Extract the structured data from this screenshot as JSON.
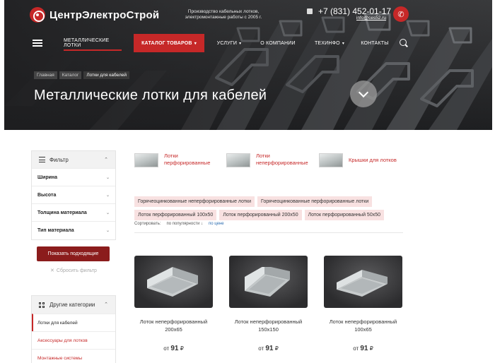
{
  "header": {
    "logo_text": "ЦентрЭлектроСтрой",
    "tagline_line1": "Производство кабельных лотков,",
    "tagline_line2": "электромонтажные работы с 2005 г.",
    "phone": "+7 (831) 452-01-17",
    "email": "info@ces52.ru"
  },
  "nav": {
    "items": [
      {
        "label": "МЕТАЛЛИЧЕСКИЕ ЛОТКИ",
        "caret": ""
      },
      {
        "label": "КАТАЛОГ ТОВАРОВ",
        "caret": "▾"
      },
      {
        "label": "УСЛУГИ",
        "caret": "▾"
      },
      {
        "label": "О КОМПАНИИ",
        "caret": ""
      },
      {
        "label": "ТЕХИНФО",
        "caret": "▾"
      },
      {
        "label": "КОНТАКТЫ",
        "caret": ""
      }
    ]
  },
  "breadcrumb": [
    "Главная",
    "Каталог",
    "Лотки для кабелей"
  ],
  "page_title": "Металлические лотки для кабелей",
  "filter": {
    "title": "Фильтр",
    "rows": [
      "Ширина",
      "Высота",
      "Толщина материала",
      "Тип материала"
    ],
    "submit_label": "Показать подходящие",
    "reset_label": "Сбросить фильтр"
  },
  "other_categories": {
    "title": "Другие категории",
    "items": [
      "Лотки для кабелей",
      "Аксессуары для лотков",
      "Монтажные системы"
    ]
  },
  "subcategories": [
    {
      "line1": "Лотки",
      "line2": "перфорированные"
    },
    {
      "line1": "Лотки",
      "line2": "неперфорированные"
    },
    {
      "line1": "Крышки для лотков",
      "line2": ""
    }
  ],
  "tags": {
    "row1": [
      "Горячеоцинкованные неперфорированные лотки",
      "Горячеоцинкованные перфорированные лотки"
    ],
    "row2": [
      "Лоток перфорированный 100х50",
      "Лоток перфорированный 200х50",
      "Лоток перфорированный 50х50"
    ]
  },
  "sort": {
    "label": "Сортировать:",
    "option1": "по популярности",
    "option1_arrow": "↓",
    "option2": "по цене"
  },
  "products": [
    {
      "name_line1": "Лоток неперфорированный",
      "name_line2": "200х65",
      "price_prefix": "от",
      "price": "91",
      "currency": "₽"
    },
    {
      "name_line1": "Лоток неперфорированный",
      "name_line2": "150х150",
      "price_prefix": "от",
      "price": "91",
      "currency": "₽"
    },
    {
      "name_line1": "Лоток неперфорированный",
      "name_line2": "100х65",
      "price_prefix": "от",
      "price": "91",
      "currency": "₽"
    }
  ],
  "colors": {
    "brand_red": "#c62828",
    "button_dark_red": "#8b1c1c",
    "tag_bg": "#f8e1e1",
    "link_blue": "#2b6cb0"
  },
  "icons": {
    "logo": "logo-icon",
    "menu": "hamburger-icon",
    "search": "search-icon",
    "call": "phone-icon",
    "filter": "sliders-icon",
    "categories": "grid-icon",
    "scroll": "chevron-down-icon",
    "reset": "close-icon"
  }
}
